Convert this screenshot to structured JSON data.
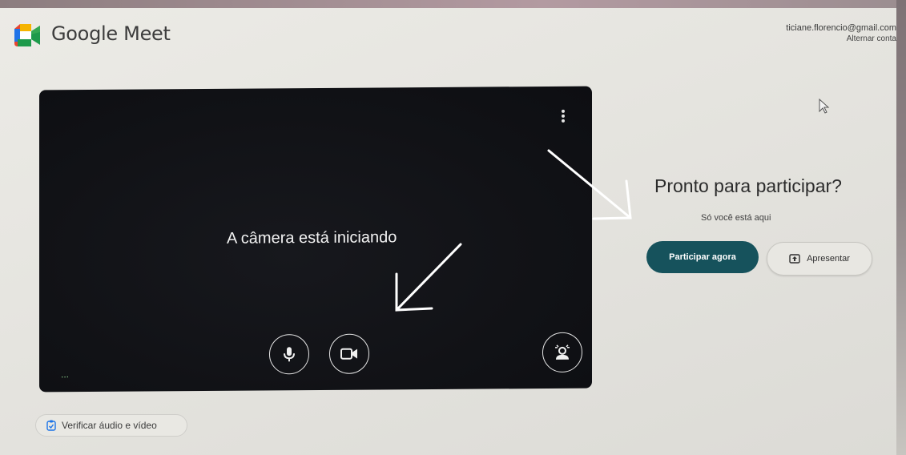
{
  "app": {
    "title": "Google Meet"
  },
  "account": {
    "email": "ticiane.florencio@gmail.com",
    "switch_label": "Alternar conta"
  },
  "preview": {
    "status": "A câmera está iniciando",
    "dots_label": "..."
  },
  "join": {
    "title": "Pronto para participar?",
    "subtitle": "Só você está aqui",
    "join_label": "Participar agora",
    "present_label": "Apresentar"
  },
  "footer": {
    "check_label": "Verificar áudio e vídeo"
  },
  "colors": {
    "accent": "#16525c",
    "preview_bg": "#111216"
  },
  "icons": [
    "google-meet-logo",
    "more-vert-icon",
    "mic-icon",
    "camera-icon",
    "visual-effects-icon",
    "present-icon",
    "check-audio-icon",
    "cursor-icon"
  ]
}
